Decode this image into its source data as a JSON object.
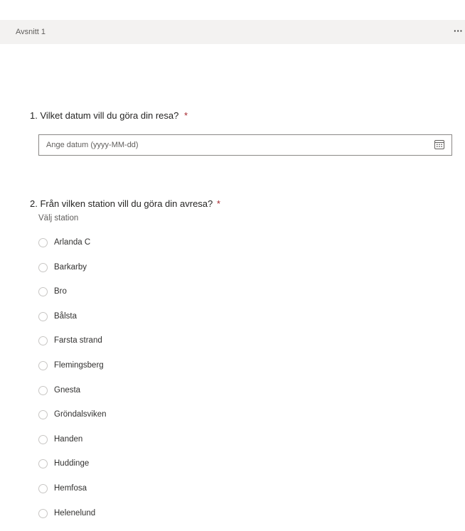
{
  "section": {
    "title": "Avsnitt 1",
    "more": "···"
  },
  "q1": {
    "number": "1.",
    "title": "Vilket datum vill du göra din resa?",
    "required": "*",
    "placeholder": "Ange datum (yyyy-MM-dd)",
    "icon": "calendar-icon"
  },
  "q2": {
    "number": "2.",
    "title": "Från vilken station vill du göra din avresa?",
    "required": "*",
    "subtitle": "Välj station",
    "options": [
      "Arlanda C",
      "Barkarby",
      "Bro",
      "Bålsta",
      "Farsta strand",
      "Flemingsberg",
      "Gnesta",
      "Gröndalsviken",
      "Handen",
      "Huddinge",
      "Hemfosa",
      "Helenelund"
    ]
  },
  "colors": {
    "required": "#a4262c",
    "section_bg": "#f3f2f1",
    "border": "#8a8886"
  }
}
